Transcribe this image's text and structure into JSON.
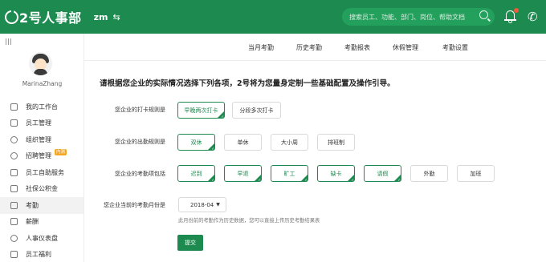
{
  "header": {
    "logo_text": "2号人事部",
    "company": "zm",
    "search_placeholder": "搜索员工、功能、部门、岗位、帮助文档",
    "accent_color": "#1d8a4f"
  },
  "sidebar": {
    "username": "MarinaZhang",
    "items": [
      {
        "label": "我的工作台",
        "icon": "monitor-icon"
      },
      {
        "label": "员工管理",
        "icon": "id-card-icon"
      },
      {
        "label": "组织管理",
        "icon": "org-icon"
      },
      {
        "label": "招聘管理",
        "icon": "user-search-icon",
        "badge": "内测"
      },
      {
        "label": "员工自助服务",
        "icon": "phone-icon"
      },
      {
        "label": "社保公积金",
        "icon": "home-icon"
      },
      {
        "label": "考勤",
        "icon": "calendar-icon",
        "active": true
      },
      {
        "label": "薪酬",
        "icon": "money-icon"
      },
      {
        "label": "人事仪表盘",
        "icon": "chart-icon"
      },
      {
        "label": "员工福利",
        "icon": "gift-icon"
      }
    ]
  },
  "tabs": [
    "当月考勤",
    "历史考勤",
    "考勤报表",
    "休假管理",
    "考勤设置"
  ],
  "main": {
    "title": "请根据您企业的实际情况选择下列各项，2号将为您量身定制一些基础配置及操作引导。",
    "rows": [
      {
        "label": "您企业的打卡规则是",
        "options": [
          {
            "label": "早晚两次打卡",
            "selected": true
          },
          {
            "label": "分段多次打卡",
            "selected": false
          }
        ]
      },
      {
        "label": "您企业的出勤规则是",
        "options": [
          {
            "label": "双休",
            "selected": true
          },
          {
            "label": "单休",
            "selected": false
          },
          {
            "label": "大小周",
            "selected": false
          },
          {
            "label": "排班制",
            "selected": false
          }
        ]
      },
      {
        "label": "您企业的考勤项包括",
        "options": [
          {
            "label": "迟到",
            "selected": true
          },
          {
            "label": "早退",
            "selected": true
          },
          {
            "label": "旷工",
            "selected": true
          },
          {
            "label": "缺卡",
            "selected": true
          },
          {
            "label": "请假",
            "selected": true
          },
          {
            "label": "外勤",
            "selected": false
          },
          {
            "label": "加班",
            "selected": false
          }
        ]
      }
    ],
    "month_label": "您企业当前的考勤月份是",
    "month_value": "2018-04",
    "hint": "此月份前的考勤作为历史数据，您可以直接上传历史考勤结果表",
    "submit_label": "提交"
  }
}
